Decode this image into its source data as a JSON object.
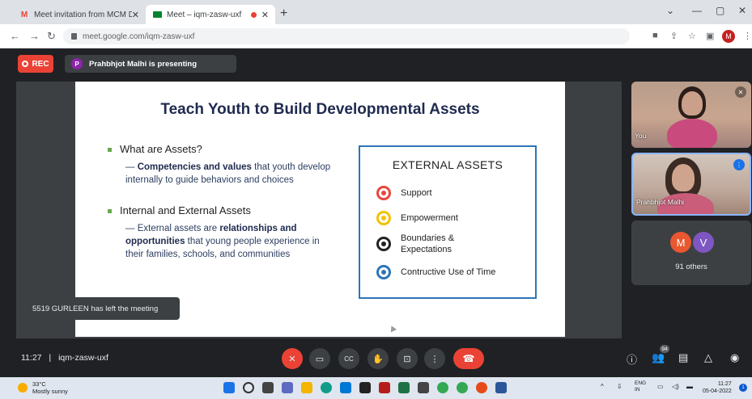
{
  "browser": {
    "tabs": [
      {
        "title": "Meet invitation from MCM DAV",
        "favicon": "gmail-icon"
      },
      {
        "title": "Meet – iqm-zasw-uxf",
        "favicon": "meet-icon"
      }
    ],
    "close_label": "✕",
    "newtab_label": "+",
    "url": "meet.google.com/iqm-zasw-uxf",
    "profile_initial": "M",
    "window_controls": [
      "⌄",
      "—",
      "▢",
      "✕"
    ]
  },
  "meet": {
    "rec_label": "REC",
    "presenter_initial": "P",
    "presenting_text": "Prahbhjot Malhi is presenting",
    "toast": "5519 GURLEEN has left the meeting",
    "time": "11:27",
    "separator": "|",
    "meeting_code": "iqm-zasw-uxf",
    "participant_count_badge": "94",
    "tiles": {
      "self_label": "You",
      "presenter_label": "Prahbhjot Malhi",
      "others_initials": [
        "M",
        "V"
      ],
      "others_colors": [
        "#e8572f",
        "#7e57c2"
      ],
      "others_text": "91 others"
    },
    "accent": "#ea4335"
  },
  "slide": {
    "title": "Teach Youth to Build Developmental Assets",
    "bullet1": "What are Assets?",
    "sub1_bold": "Competencies and values",
    "sub1_rest": " that youth develop internally to guide behaviors and choices",
    "bullet2": "Internal and External Assets",
    "sub2_pre": "External assets are ",
    "sub2_bold": "relationships and opportunities",
    "sub2_rest": " that young people experience in their families, schools, and communities",
    "dash": "—",
    "box_title": "EXTERNAL ASSETS",
    "items": [
      {
        "label": "Support",
        "color": "#e8453c"
      },
      {
        "label": "Empowerment",
        "color": "#f2c200"
      },
      {
        "label": "Boundaries & Expectations",
        "color": "#222222"
      },
      {
        "label": "Contructive Use of Time",
        "color": "#2e75b6"
      }
    ]
  },
  "taskbar": {
    "temperature": "33°C",
    "weather": "Mostly sunny",
    "lang": "ENG",
    "region": "IN",
    "clock": "11:27",
    "date": "05-04-2022",
    "notifications": "1"
  }
}
